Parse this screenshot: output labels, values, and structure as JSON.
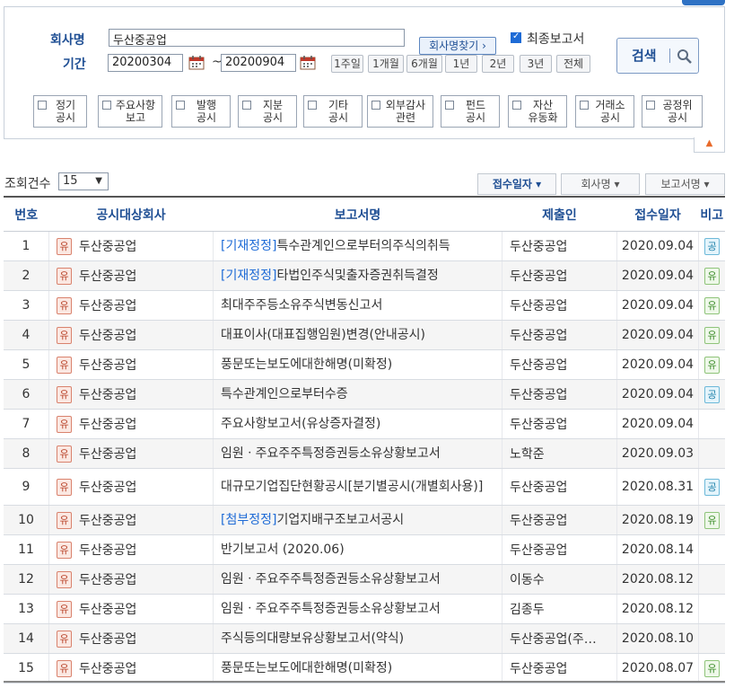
{
  "form": {
    "company_label": "회사명",
    "company_value": "두산중공업",
    "find_btn": "회사명찾기 ›",
    "final_report_label": "최종보고서",
    "period_label": "기간",
    "date_from": "20200304",
    "date_to": "20200904",
    "dash": "~",
    "periods": [
      "1주일",
      "1개월",
      "6개월",
      "1년",
      "2년",
      "3년",
      "전체"
    ],
    "search_btn": "검색"
  },
  "categories": [
    [
      "정기",
      "공시"
    ],
    [
      "주요사항",
      "보고"
    ],
    [
      "발행",
      "공시"
    ],
    [
      "지분",
      "공시"
    ],
    [
      "기타",
      "공시"
    ],
    [
      "외부감사",
      "관련"
    ],
    [
      "펀드",
      "공시"
    ],
    [
      "자산",
      "유동화"
    ],
    [
      "거래소",
      "공시"
    ],
    [
      "공정위",
      "공시"
    ]
  ],
  "list": {
    "count_label": "조회건수",
    "count_value": "15",
    "sort": [
      "접수일자 ▾",
      "회사명 ▾",
      "보고서명 ▾"
    ],
    "headers": [
      "번호",
      "공시대상회사",
      "보고서명",
      "제출인",
      "접수일자",
      "비고"
    ]
  },
  "rows": [
    {
      "n": "1",
      "badge": "유",
      "company": "두산중공업",
      "tag": "[기재정정]",
      "report": "특수관계인으로부터의주식의취득",
      "submitter": "두산중공업",
      "date": "2020.09.04",
      "note": "공"
    },
    {
      "n": "2",
      "badge": "유",
      "company": "두산중공업",
      "tag": "[기재정정]",
      "report": "타법인주식및출자증권취득결정",
      "submitter": "두산중공업",
      "date": "2020.09.04",
      "note": "유"
    },
    {
      "n": "3",
      "badge": "유",
      "company": "두산중공업",
      "tag": "",
      "report": "최대주주등소유주식변동신고서",
      "submitter": "두산중공업",
      "date": "2020.09.04",
      "note": "유"
    },
    {
      "n": "4",
      "badge": "유",
      "company": "두산중공업",
      "tag": "",
      "report": "대표이사(대표집행임원)변경(안내공시)",
      "submitter": "두산중공업",
      "date": "2020.09.04",
      "note": "유"
    },
    {
      "n": "5",
      "badge": "유",
      "company": "두산중공업",
      "tag": "",
      "report": "풍문또는보도에대한해명(미확정)",
      "submitter": "두산중공업",
      "date": "2020.09.04",
      "note": "유"
    },
    {
      "n": "6",
      "badge": "유",
      "company": "두산중공업",
      "tag": "",
      "report": "특수관계인으로부터수증",
      "submitter": "두산중공업",
      "date": "2020.09.04",
      "note": "공"
    },
    {
      "n": "7",
      "badge": "유",
      "company": "두산중공업",
      "tag": "",
      "report": "주요사항보고서(유상증자결정)",
      "submitter": "두산중공업",
      "date": "2020.09.04",
      "note": ""
    },
    {
      "n": "8",
      "badge": "유",
      "company": "두산중공업",
      "tag": "",
      "report": "임원ㆍ주요주주특정증권등소유상황보고서",
      "submitter": "노학준",
      "date": "2020.09.03",
      "note": ""
    },
    {
      "n": "9",
      "badge": "유",
      "company": "두산중공업",
      "tag": "",
      "report": "대규모기업집단현황공시[분기별공시(개별회사용)]",
      "submitter": "두산중공업",
      "date": "2020.08.31",
      "note": "공"
    },
    {
      "n": "10",
      "badge": "유",
      "company": "두산중공업",
      "tag": "[첨부정정]",
      "report": "기업지배구조보고서공시",
      "submitter": "두산중공업",
      "date": "2020.08.19",
      "note": "유"
    },
    {
      "n": "11",
      "badge": "유",
      "company": "두산중공업",
      "tag": "",
      "report": "반기보고서 (2020.06)",
      "submitter": "두산중공업",
      "date": "2020.08.14",
      "note": ""
    },
    {
      "n": "12",
      "badge": "유",
      "company": "두산중공업",
      "tag": "",
      "report": "임원ㆍ주요주주특정증권등소유상황보고서",
      "submitter": "이동수",
      "date": "2020.08.12",
      "note": ""
    },
    {
      "n": "13",
      "badge": "유",
      "company": "두산중공업",
      "tag": "",
      "report": "임원ㆍ주요주주특정증권등소유상황보고서",
      "submitter": "김종두",
      "date": "2020.08.12",
      "note": ""
    },
    {
      "n": "14",
      "badge": "유",
      "company": "두산중공업",
      "tag": "",
      "report": "주식등의대량보유상황보고서(약식)",
      "submitter": "두산중공업(주…",
      "date": "2020.08.10",
      "note": ""
    },
    {
      "n": "15",
      "badge": "유",
      "company": "두산중공업",
      "tag": "",
      "report": "풍문또는보도에대한해명(미확정)",
      "submitter": "두산중공업",
      "date": "2020.08.07",
      "note": "유"
    }
  ]
}
